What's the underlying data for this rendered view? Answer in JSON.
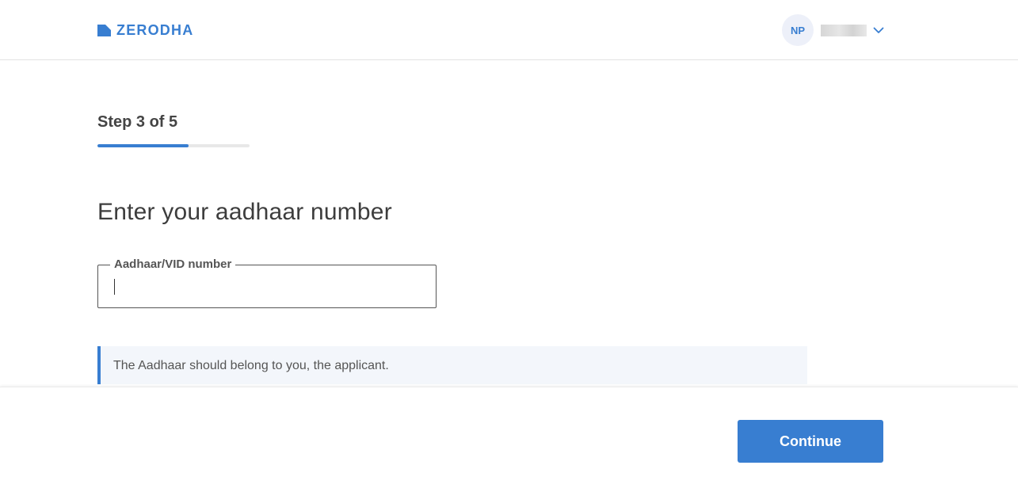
{
  "header": {
    "brand": "ZERODHA",
    "user": {
      "initials": "NP"
    }
  },
  "colors": {
    "accent": "#387ed1",
    "progress_track": "#e8e8e8",
    "notice_bg": "#f3f6fb"
  },
  "icons": {
    "logo": "zerodha-logo-icon",
    "dropdown": "chevron-down-icon"
  },
  "step": {
    "label": "Step 3 of 5",
    "progress_fraction": 0.6
  },
  "main": {
    "title": "Enter your aadhaar number",
    "aadhaar_field": {
      "label": "Aadhaar/VID number",
      "value": ""
    },
    "notice": "The Aadhaar should belong to you, the applicant."
  },
  "footer": {
    "continue_label": "Continue"
  }
}
